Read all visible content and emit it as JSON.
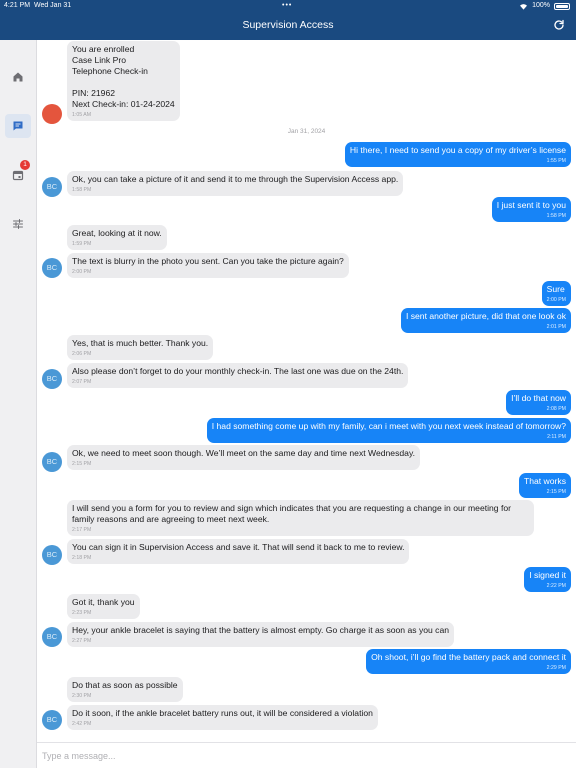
{
  "status_bar": {
    "time": "4:21 PM",
    "date": "Wed Jan 31",
    "battery": "100%"
  },
  "header": {
    "title": "Supervision Access",
    "refresh_icon": "refresh-icon"
  },
  "sidebar": {
    "items": [
      {
        "icon": "home-icon"
      },
      {
        "icon": "chat-icon",
        "active": true
      },
      {
        "icon": "calendar-icon",
        "badge": "1"
      },
      {
        "icon": "sliders-icon"
      }
    ]
  },
  "avatar_initials": "BC",
  "date_separator": "Jan 31, 2024",
  "messages": [
    {
      "dir": "in",
      "text": "You are enrolled\nCase Link Pro\nTelephone Check-in\n\nPIN: 21962\nNext Check-in: 01-24-2024",
      "time": "1:05 AM"
    },
    {
      "dir": "out",
      "text": "Hi there, I need to send you a copy of my driver’s license",
      "time": "1:55 PM"
    },
    {
      "dir": "in",
      "text": "Ok, you can take a picture of it and send it to me through the Supervision Access app.",
      "time": "1:58 PM"
    },
    {
      "dir": "out",
      "text": "I just sent it to you",
      "time": "1:58 PM"
    },
    {
      "dir": "in",
      "text": "Great, looking at it now.",
      "time": "1:59 PM"
    },
    {
      "dir": "in",
      "text": "The text is blurry in the photo you sent. Can you take the picture again?",
      "time": "2:00 PM"
    },
    {
      "dir": "out",
      "text": "Sure",
      "time": "2:00 PM"
    },
    {
      "dir": "out",
      "text": "I sent another picture, did that one look ok",
      "time": "2:01 PM"
    },
    {
      "dir": "in",
      "text": "Yes, that is much better. Thank you.",
      "time": "2:06 PM"
    },
    {
      "dir": "in",
      "text": "Also please don’t forget to do your monthly check-in. The last one was due on the 24th.",
      "time": "2:07 PM"
    },
    {
      "dir": "out",
      "text": "I’ll do that now",
      "time": "2:08 PM"
    },
    {
      "dir": "out",
      "text": "I had something come up with my family, can i meet with you next week instead of tomorrow?",
      "time": "2:11 PM"
    },
    {
      "dir": "in",
      "text": "Ok, we need to meet soon though. We’ll meet on the same day and time next Wednesday.",
      "time": "2:15 PM"
    },
    {
      "dir": "out",
      "text": "That works",
      "time": "2:15 PM"
    },
    {
      "dir": "in",
      "text": "I will send you a form for you to review and sign which indicates that you are requesting a change in our meeting for family reasons and are agreeing to meet next week.",
      "time": "2:17 PM"
    },
    {
      "dir": "in",
      "text": "You can sign it in Supervision Access and save it. That will send it back to me to review.",
      "time": "2:18 PM"
    },
    {
      "dir": "out",
      "text": "I signed it",
      "time": "2:22 PM"
    },
    {
      "dir": "in",
      "text": "Got it, thank you",
      "time": "2:23 PM"
    },
    {
      "dir": "in",
      "text": "Hey, your ankle bracelet is saying that the battery is almost empty. Go charge it as soon as you can",
      "time": "2:27 PM"
    },
    {
      "dir": "out",
      "text": "Oh shoot, i’ll go find the battery pack and connect it",
      "time": "2:29 PM"
    },
    {
      "dir": "in",
      "text": "Do that as soon as possible",
      "time": "2:30 PM"
    },
    {
      "dir": "in",
      "text": "Do it soon, if the ankle bracelet battery runs out, it will be considered a violation",
      "time": "2:42 PM"
    }
  ],
  "composer": {
    "placeholder": "Type a message..."
  },
  "colors": {
    "header": "#1a4a80",
    "outgoing": "#1784f7",
    "incoming": "#ebebed",
    "avatar": "#4a98d6",
    "badge": "#e53935"
  }
}
